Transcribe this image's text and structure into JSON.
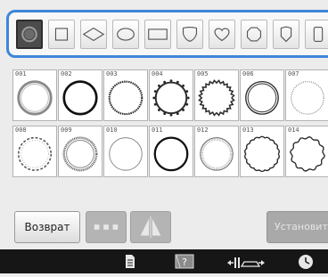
{
  "shape_selector": {
    "shapes": [
      {
        "name": "circle-icon",
        "selected": true
      },
      {
        "name": "square-icon",
        "selected": false
      },
      {
        "name": "diamond-icon",
        "selected": false
      },
      {
        "name": "ellipse-icon",
        "selected": false
      },
      {
        "name": "rectangle-icon",
        "selected": false
      },
      {
        "name": "shield-icon",
        "selected": false
      },
      {
        "name": "heart-icon",
        "selected": false
      },
      {
        "name": "octagon-icon",
        "selected": false
      },
      {
        "name": "shield-alt-icon",
        "selected": false
      },
      {
        "name": "rounded-rect-icon",
        "selected": false
      }
    ]
  },
  "patterns": [
    {
      "id": "001",
      "style": "solid-double"
    },
    {
      "id": "002",
      "style": "solid-thick"
    },
    {
      "id": "003",
      "style": "beaded"
    },
    {
      "id": "004",
      "style": "scalloped-dots"
    },
    {
      "id": "005",
      "style": "zigzag"
    },
    {
      "id": "006",
      "style": "double-thin"
    },
    {
      "id": "007",
      "style": "dotted"
    },
    {
      "id": "008",
      "style": "dashed-ornament"
    },
    {
      "id": "009",
      "style": "cross-stitch"
    },
    {
      "id": "010",
      "style": "thin"
    },
    {
      "id": "011",
      "style": "solid-bold"
    },
    {
      "id": "012",
      "style": "fringe"
    },
    {
      "id": "013",
      "style": "scalloped"
    },
    {
      "id": "014",
      "style": "wavy"
    }
  ],
  "buttons": {
    "back_label": "Возврат",
    "set_label": "Установить"
  },
  "status_bar": {
    "icons": [
      "document-icon",
      "help-icon",
      "presser-foot-icon",
      "clock-icon"
    ]
  },
  "colors": {
    "accent": "#3e86d8",
    "status_bar_bg": "#161616"
  }
}
